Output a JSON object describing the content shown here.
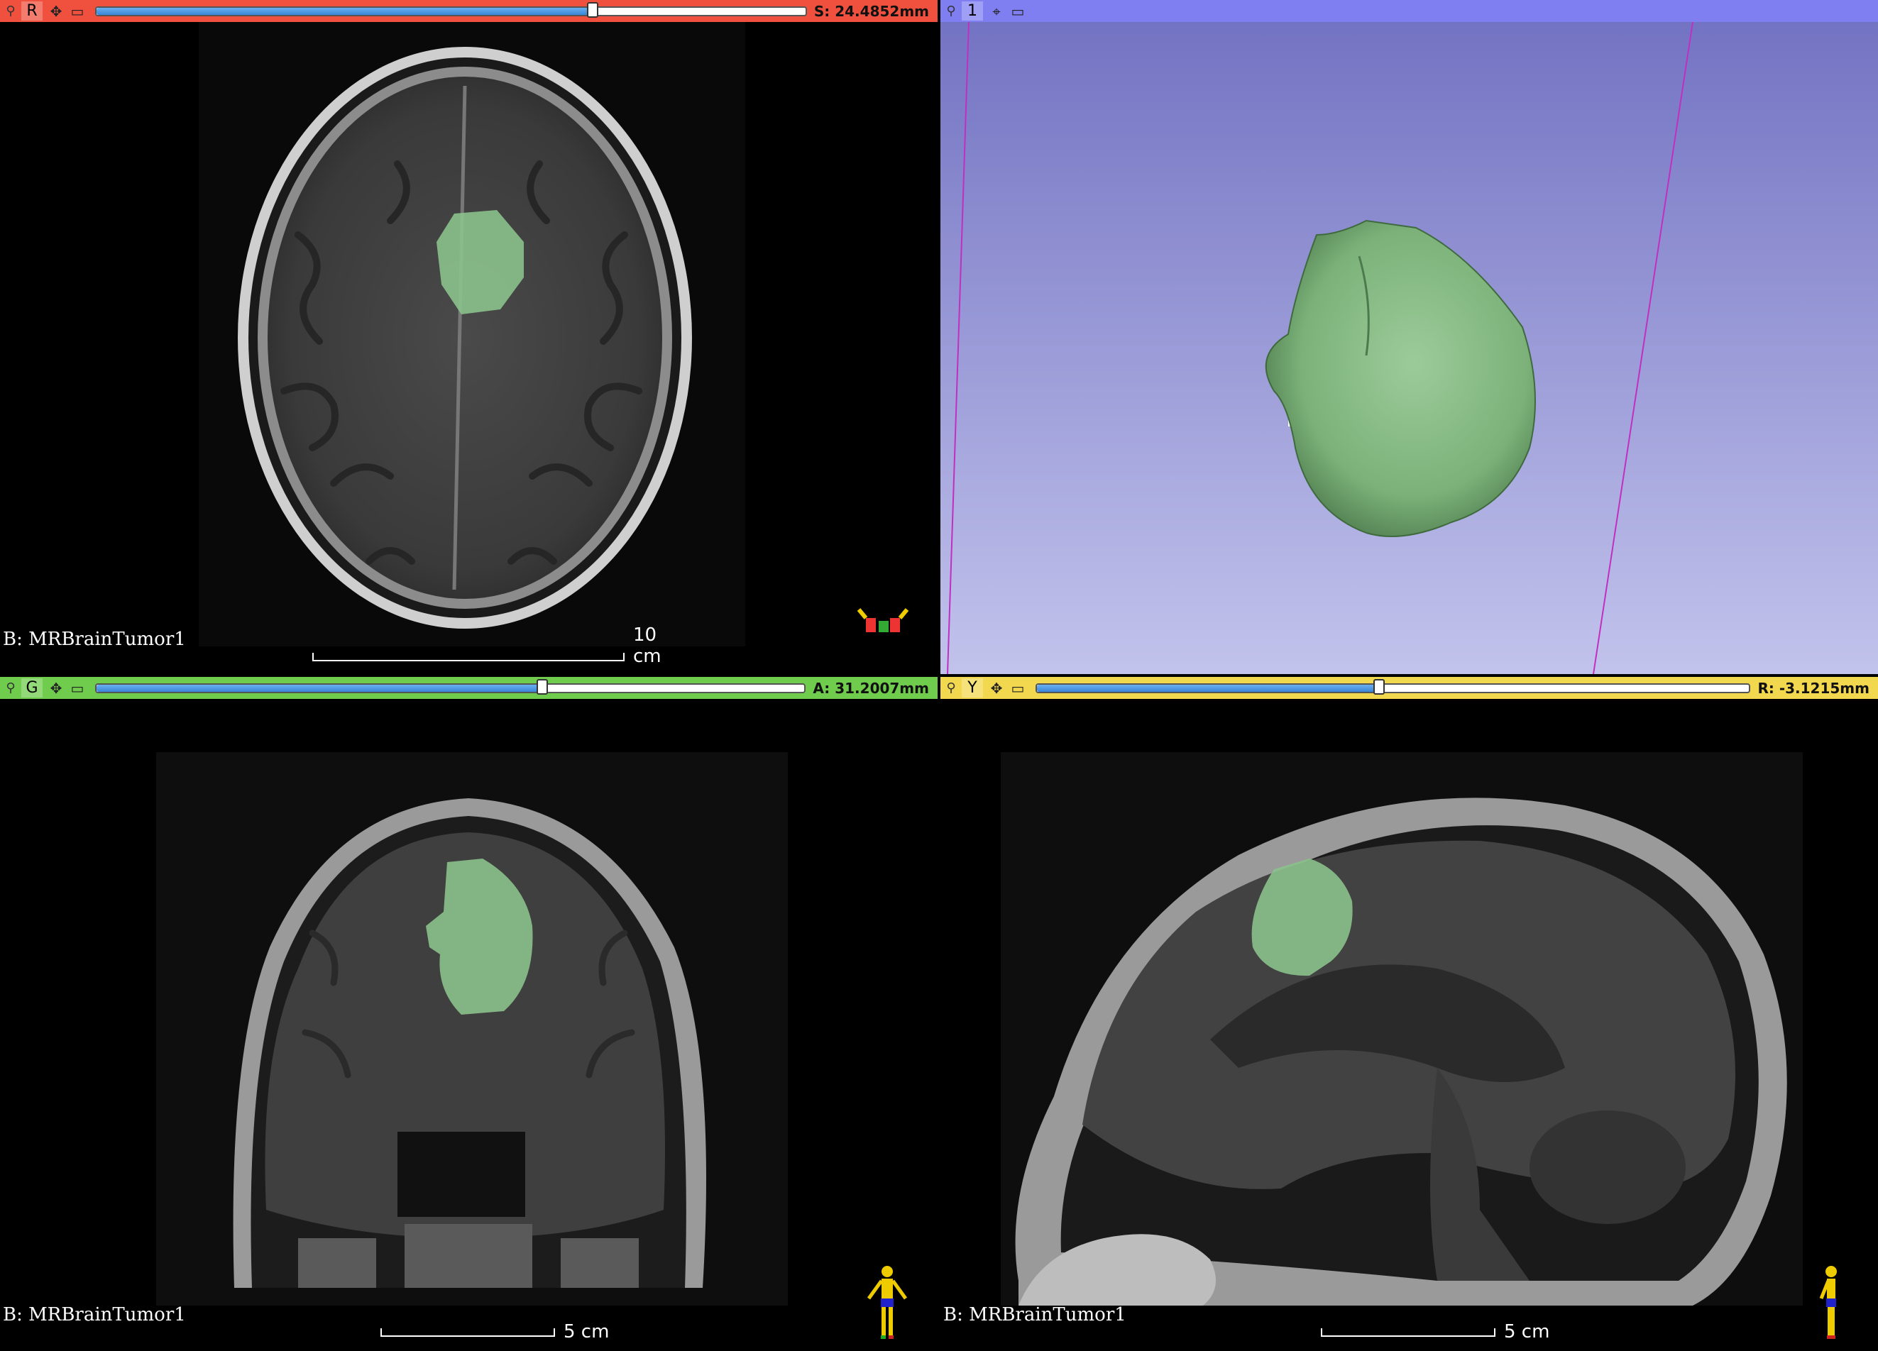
{
  "views": {
    "red": {
      "label": "R",
      "bar_color": "#f0513f",
      "offset_readout": "S: 24.4852mm",
      "slider_fraction": 0.7,
      "background_label": "B: MRBrainTumor1",
      "ruler_label": "10 cm",
      "pin_icon": "pin-icon"
    },
    "threed": {
      "label": "1",
      "bar_color": "#7f7ff2",
      "bg_top": "#7373c3",
      "bg_bottom": "#c2c3ec",
      "segment_color": "#8bc18b"
    },
    "green": {
      "label": "G",
      "bar_color": "#6fcc4c",
      "offset_readout": "A: 31.2007mm",
      "slider_fraction": 0.63,
      "background_label": "B: MRBrainTumor1",
      "ruler_label": "5 cm"
    },
    "yellow": {
      "label": "Y",
      "bar_color": "#f2d84e",
      "offset_readout": "R: -3.1215mm",
      "slider_fraction": 0.48,
      "background_label": "B: MRBrainTumor1",
      "ruler_label": "5 cm"
    }
  }
}
